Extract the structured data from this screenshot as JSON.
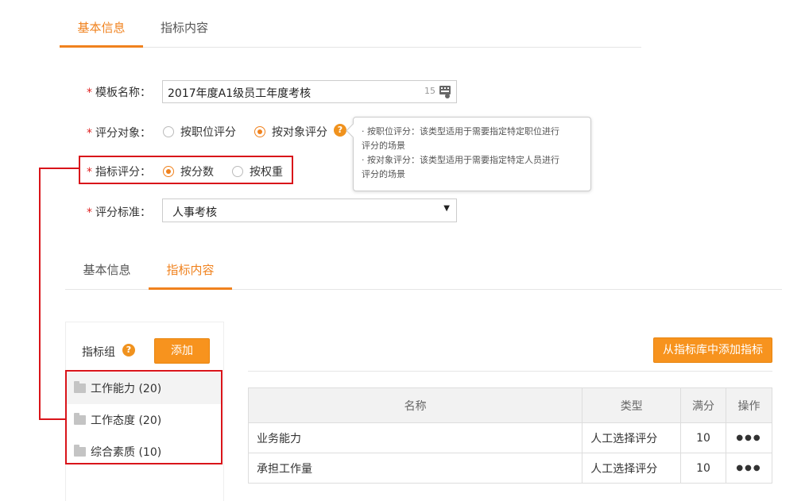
{
  "top_tabs": [
    "基本信息",
    "指标内容"
  ],
  "form": {
    "template_name_label": "模板名称：",
    "template_name_value": "2017年度A1级员工年度考核",
    "template_name_count": "15",
    "target_label": "评分对象：",
    "target_options": [
      "按职位评分",
      "按对象评分"
    ],
    "target_selected": 1,
    "metric_label": "指标评分：",
    "metric_options": [
      "按分数",
      "按权重"
    ],
    "metric_selected": 0,
    "standard_label": "评分标准：",
    "standard_value": "人事考核",
    "required_mark": "*"
  },
  "tooltip": {
    "lines": [
      "· 按职位评分：该类型适用于需要指定特定职位进行",
      "评分的场景",
      "· 按对象评分：该类型适用于需要指定特定人员进行",
      "评分的场景"
    ]
  },
  "content_tabs": [
    "基本信息",
    "指标内容"
  ],
  "group_panel": {
    "title": "指标组",
    "add_button": "添加",
    "items": [
      "工作能力 (20)",
      "工作态度 (20)",
      "综合素质 (10)"
    ]
  },
  "library_button": "从指标库中添加指标",
  "table": {
    "headers": [
      "名称",
      "类型",
      "满分",
      "操作"
    ],
    "rows": [
      {
        "name": "业务能力",
        "type": "人工选择评分",
        "score": "10",
        "op": "●●●"
      },
      {
        "name": "承担工作量",
        "type": "人工选择评分",
        "score": "10",
        "op": "●●●"
      }
    ]
  },
  "icons": {
    "help": "?",
    "select_arrow": "▼"
  },
  "colors": {
    "accent": "#f0821e",
    "highlight": "#d9141a"
  }
}
